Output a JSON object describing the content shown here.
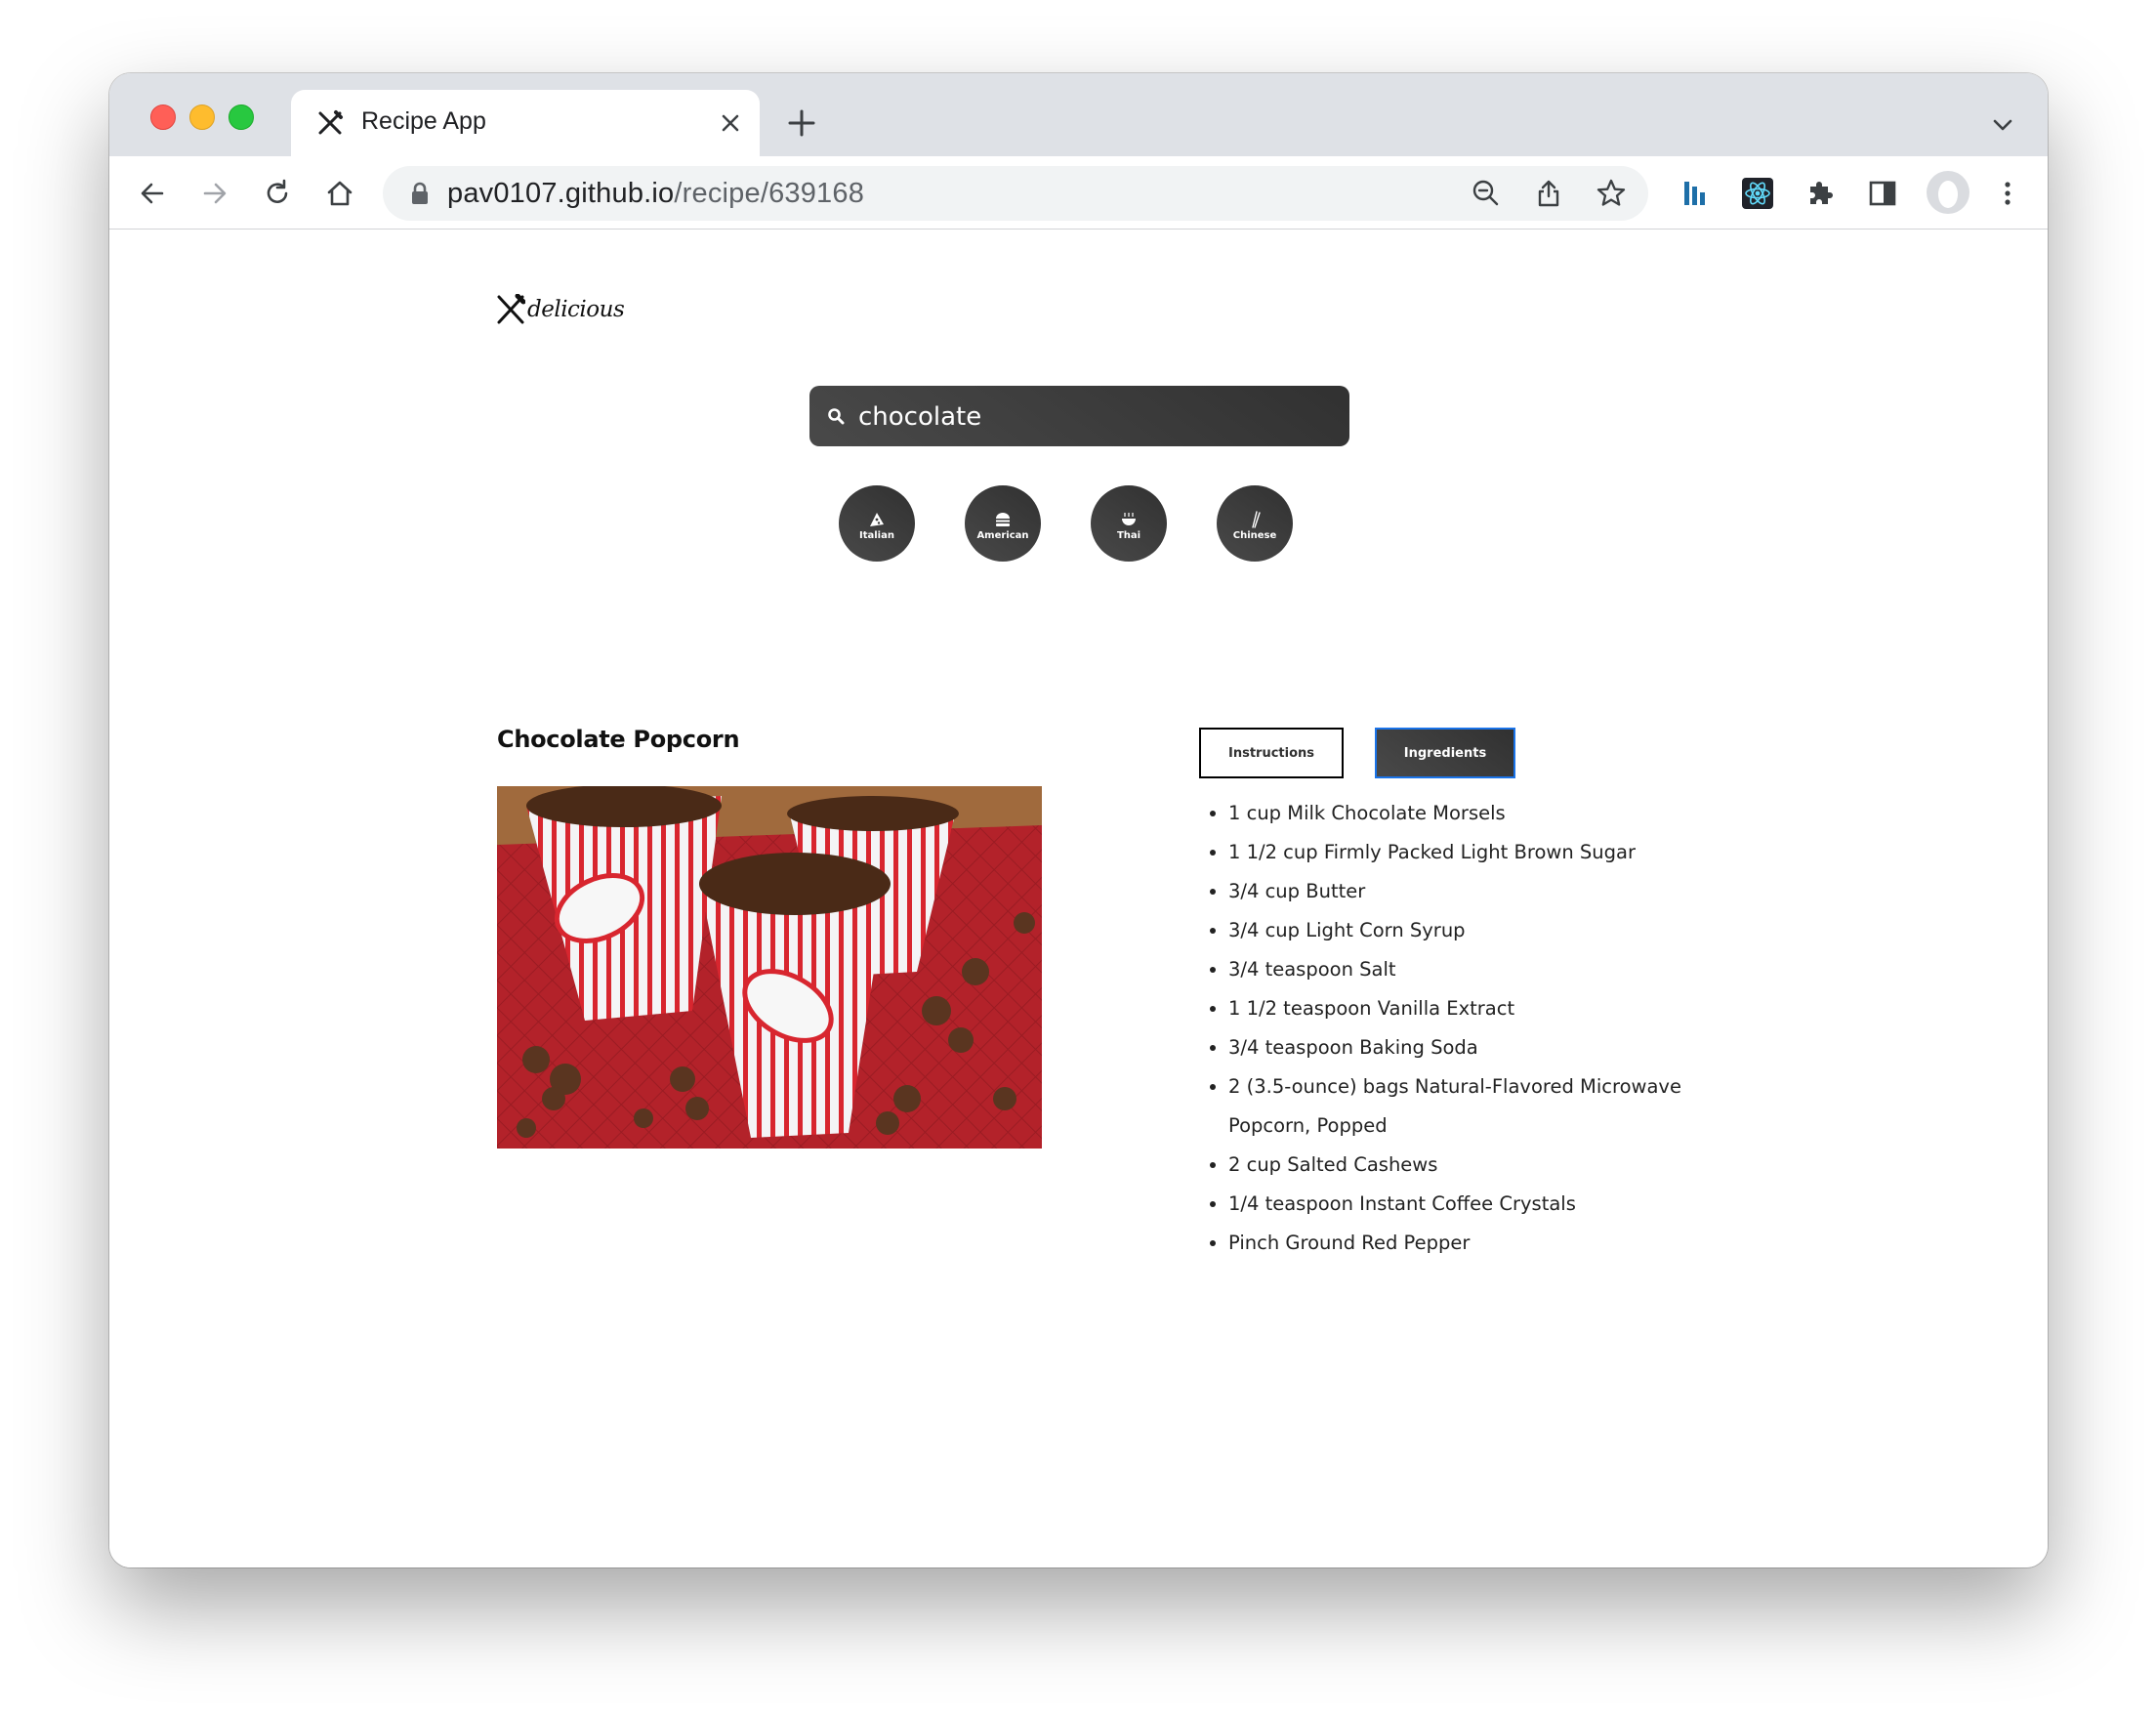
{
  "browser": {
    "tab_title": "Recipe App",
    "url_host": "pav0107.github.io",
    "url_path": "/recipe/639168"
  },
  "app": {
    "logo_text": "delicious",
    "search": {
      "value": "chocolate",
      "placeholder": ""
    },
    "cuisines": [
      {
        "label": "Italian",
        "icon": "pizza-icon"
      },
      {
        "label": "American",
        "icon": "hamburger-icon"
      },
      {
        "label": "Thai",
        "icon": "noodle-bowl-icon"
      },
      {
        "label": "Chinese",
        "icon": "chopsticks-icon"
      }
    ]
  },
  "recipe": {
    "title": "Chocolate Popcorn",
    "image_alt": "chocolate-popcorn-photo",
    "tabs": {
      "instructions": "Instructions",
      "ingredients": "Ingredients",
      "active": "Ingredients"
    },
    "ingredients": [
      "1 cup Milk Chocolate Morsels",
      "1 1/2 cup Firmly Packed Light Brown Sugar",
      "3/4 cup Butter",
      "3/4 cup Light Corn Syrup",
      "3/4 teaspoon Salt",
      "1 1/2 teaspoon Vanilla Extract",
      "3/4 teaspoon Baking Soda",
      "2 (3.5-ounce) bags Natural-Flavored Microwave Popcorn, Popped",
      "2 cup Salted Cashews",
      "1/4 teaspoon Instant Coffee Crystals",
      "Pinch Ground Red Pepper"
    ]
  },
  "colors": {
    "accent": "#313131",
    "focus": "#1a73e8",
    "tab_strip": "#dee1e6"
  }
}
